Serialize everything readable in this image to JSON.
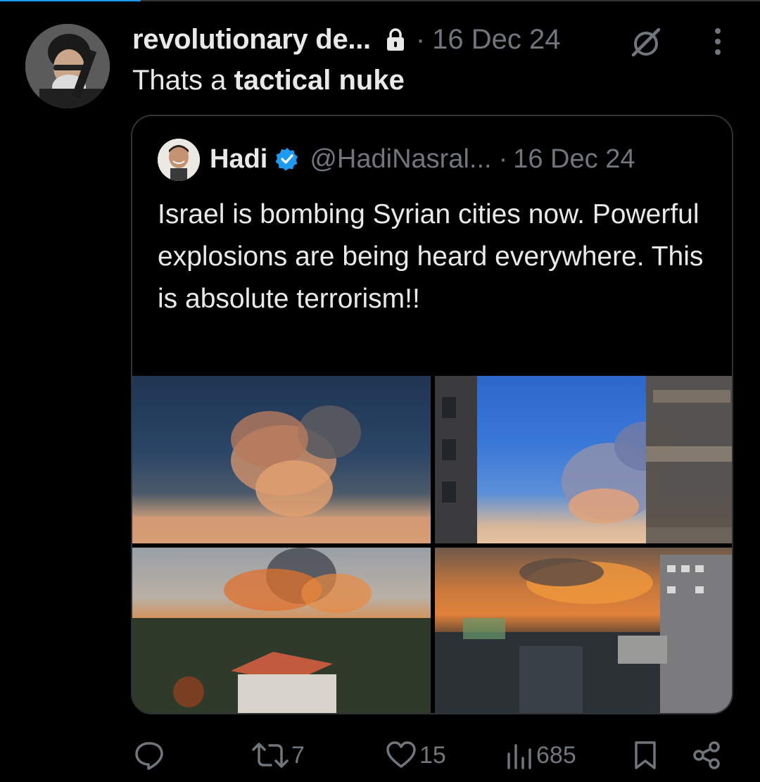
{
  "post": {
    "display_name": "revolutionary de...",
    "separator": "·",
    "timestamp": "16 Dec 24",
    "text_plain": "Thats a ",
    "text_bold": "tactical nuke"
  },
  "quote": {
    "name": "Hadi",
    "handle": "@HadiNasral...",
    "separator": "·",
    "timestamp": "16 Dec 24",
    "text": "Israel is bombing Syrian cities now. Powerful explosions are being heard everywhere. This is absolute terrorism!!"
  },
  "actions": {
    "reposts": "7",
    "likes": "15",
    "views": "685"
  },
  "icons": [
    "lock-icon",
    "grok-icon",
    "more-icon",
    "verified-icon",
    "reply-icon",
    "repost-icon",
    "like-icon",
    "views-icon",
    "bookmark-icon",
    "share-icon"
  ],
  "colors": {
    "background": "#000000",
    "text": "#e7e9ea",
    "muted": "#71767b",
    "border": "#2f3336",
    "verified": "#1d9bf0"
  }
}
